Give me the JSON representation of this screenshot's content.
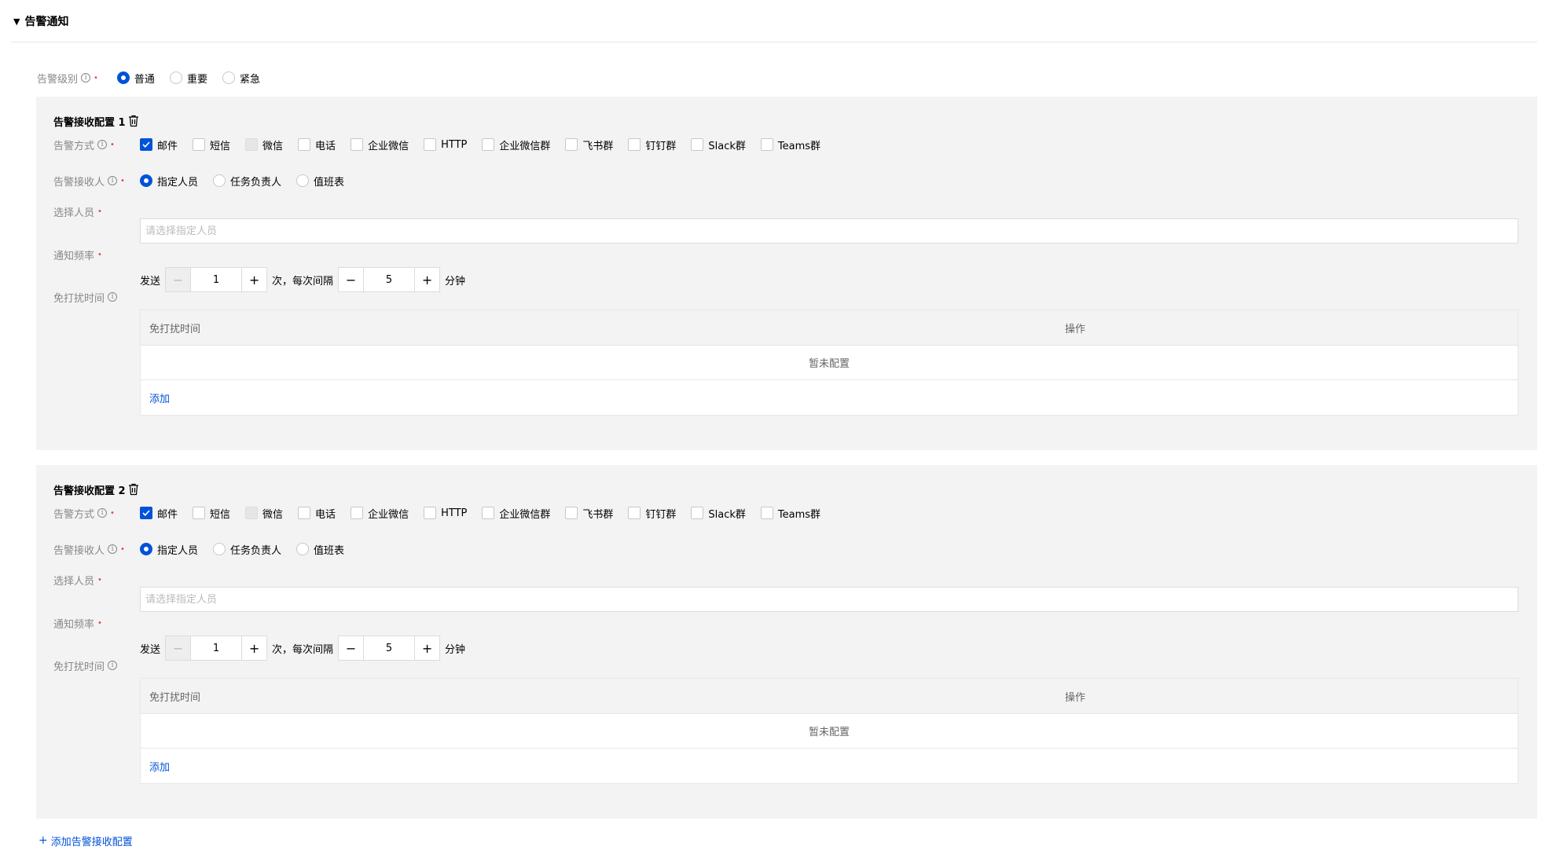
{
  "section": {
    "caret": "▼",
    "title": "告警通知"
  },
  "alert_level": {
    "label": "告警级别",
    "options": [
      {
        "label": "普通",
        "checked": true
      },
      {
        "label": "重要",
        "checked": false
      },
      {
        "label": "紧急",
        "checked": false
      }
    ]
  },
  "configs": [
    {
      "title": "告警接收配置 1",
      "method": {
        "label": "告警方式",
        "options": [
          {
            "label": "邮件",
            "checked": true,
            "disabled": false
          },
          {
            "label": "短信",
            "checked": false,
            "disabled": false
          },
          {
            "label": "微信",
            "checked": false,
            "disabled": true
          },
          {
            "label": "电话",
            "checked": false,
            "disabled": false
          },
          {
            "label": "企业微信",
            "checked": false,
            "disabled": false
          },
          {
            "label": "HTTP",
            "checked": false,
            "disabled": false
          },
          {
            "label": "企业微信群",
            "checked": false,
            "disabled": false
          },
          {
            "label": "飞书群",
            "checked": false,
            "disabled": false
          },
          {
            "label": "钉钉群",
            "checked": false,
            "disabled": false
          },
          {
            "label": "Slack群",
            "checked": false,
            "disabled": false
          },
          {
            "label": "Teams群",
            "checked": false,
            "disabled": false
          }
        ]
      },
      "receiver": {
        "label": "告警接收人",
        "options": [
          {
            "label": "指定人员",
            "checked": true
          },
          {
            "label": "任务负责人",
            "checked": false
          },
          {
            "label": "值班表",
            "checked": false
          }
        ]
      },
      "select_person": {
        "label": "选择人员",
        "placeholder": "请选择指定人员"
      },
      "frequency": {
        "label": "通知频率",
        "prefix": "发送",
        "count": "1",
        "middle": "次，每次间隔",
        "interval": "5",
        "suffix": "分钟"
      },
      "dnd": {
        "label": "免打扰时间",
        "col_time": "免打扰时间",
        "col_action": "操作",
        "empty": "暂未配置",
        "add": "添加"
      }
    },
    {
      "title": "告警接收配置 2",
      "method": {
        "label": "告警方式",
        "options": [
          {
            "label": "邮件",
            "checked": true,
            "disabled": false
          },
          {
            "label": "短信",
            "checked": false,
            "disabled": false
          },
          {
            "label": "微信",
            "checked": false,
            "disabled": true
          },
          {
            "label": "电话",
            "checked": false,
            "disabled": false
          },
          {
            "label": "企业微信",
            "checked": false,
            "disabled": false
          },
          {
            "label": "HTTP",
            "checked": false,
            "disabled": false
          },
          {
            "label": "企业微信群",
            "checked": false,
            "disabled": false
          },
          {
            "label": "飞书群",
            "checked": false,
            "disabled": false
          },
          {
            "label": "钉钉群",
            "checked": false,
            "disabled": false
          },
          {
            "label": "Slack群",
            "checked": false,
            "disabled": false
          },
          {
            "label": "Teams群",
            "checked": false,
            "disabled": false
          }
        ]
      },
      "receiver": {
        "label": "告警接收人",
        "options": [
          {
            "label": "指定人员",
            "checked": true
          },
          {
            "label": "任务负责人",
            "checked": false
          },
          {
            "label": "值班表",
            "checked": false
          }
        ]
      },
      "select_person": {
        "label": "选择人员",
        "placeholder": "请选择指定人员"
      },
      "frequency": {
        "label": "通知频率",
        "prefix": "发送",
        "count": "1",
        "middle": "次，每次间隔",
        "interval": "5",
        "suffix": "分钟"
      },
      "dnd": {
        "label": "免打扰时间",
        "col_time": "免打扰时间",
        "col_action": "操作",
        "empty": "暂未配置",
        "add": "添加"
      }
    }
  ],
  "add_config": {
    "icon": "+",
    "label": "添加告警接收配置"
  },
  "colors": {
    "primary": "#0052d9",
    "required": "#e54545",
    "panel_bg": "#f3f3f3",
    "label_gray": "#888888"
  }
}
